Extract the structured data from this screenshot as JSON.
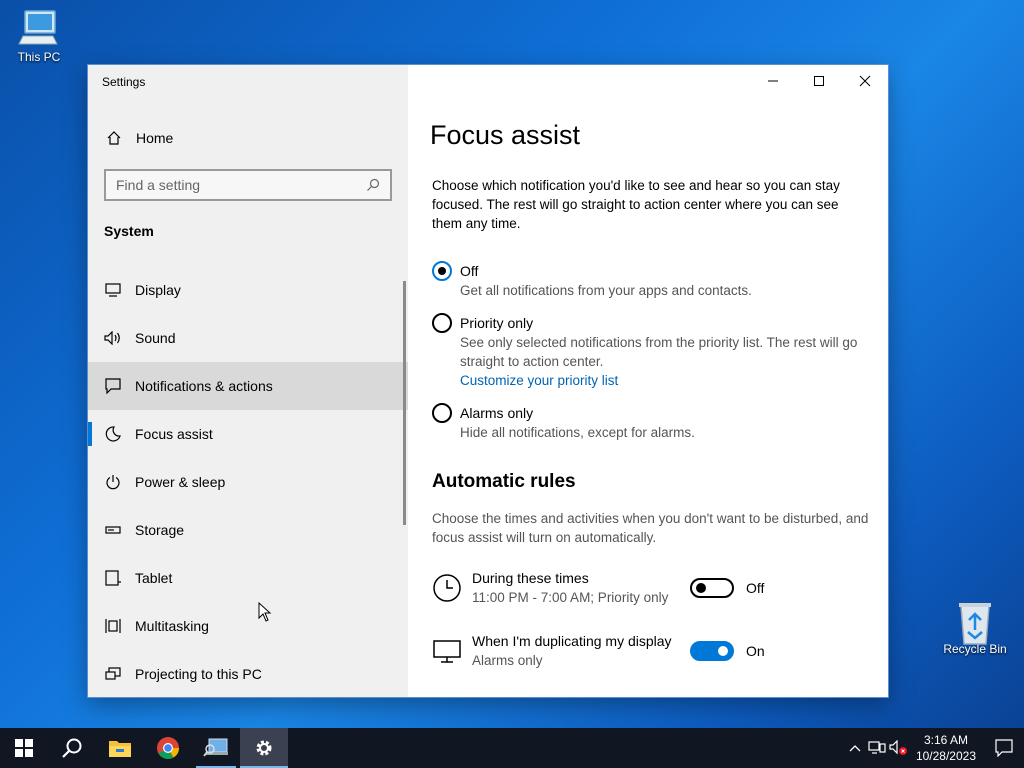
{
  "desktop": {
    "this_pc_label": "This PC",
    "recycle_bin_label": "Recycle Bin"
  },
  "window": {
    "title": "Settings",
    "accent_color": "#0078d7"
  },
  "sidebar": {
    "home_label": "Home",
    "search_placeholder": "Find a setting",
    "section_title": "System",
    "items": [
      {
        "label": "Display",
        "icon": "monitor-icon"
      },
      {
        "label": "Sound",
        "icon": "speaker-icon"
      },
      {
        "label": "Notifications & actions",
        "icon": "notification-icon"
      },
      {
        "label": "Focus assist",
        "icon": "moon-icon"
      },
      {
        "label": "Power & sleep",
        "icon": "power-icon"
      },
      {
        "label": "Storage",
        "icon": "storage-icon"
      },
      {
        "label": "Tablet",
        "icon": "tablet-icon"
      },
      {
        "label": "Multitasking",
        "icon": "multitasking-icon"
      },
      {
        "label": "Projecting to this PC",
        "icon": "projecting-icon"
      }
    ]
  },
  "main": {
    "title": "Focus assist",
    "intro": "Choose which notification you'd like to see and hear so you can stay focused. The rest will go straight to action center where you can see them any time.",
    "options": [
      {
        "label": "Off",
        "desc": "Get all notifications from your apps and contacts.",
        "selected": true
      },
      {
        "label": "Priority only",
        "desc": "See only selected notifications from the priority list. The rest will go straight to action center.",
        "link": "Customize your priority list",
        "selected": false
      },
      {
        "label": "Alarms only",
        "desc": "Hide all notifications, except for alarms.",
        "selected": false
      }
    ],
    "rules_title": "Automatic rules",
    "rules_desc": "Choose the times and activities when you don't want to be disturbed, and focus assist will turn on automatically.",
    "rules": [
      {
        "name": "During these times",
        "sub": "11:00 PM - 7:00 AM; Priority only",
        "state": "Off",
        "on": false
      },
      {
        "name": "When I'm duplicating my display",
        "sub": "Alarms only",
        "state": "On",
        "on": true
      }
    ]
  },
  "taskbar": {
    "time": "3:16 AM",
    "date": "10/28/2023"
  }
}
